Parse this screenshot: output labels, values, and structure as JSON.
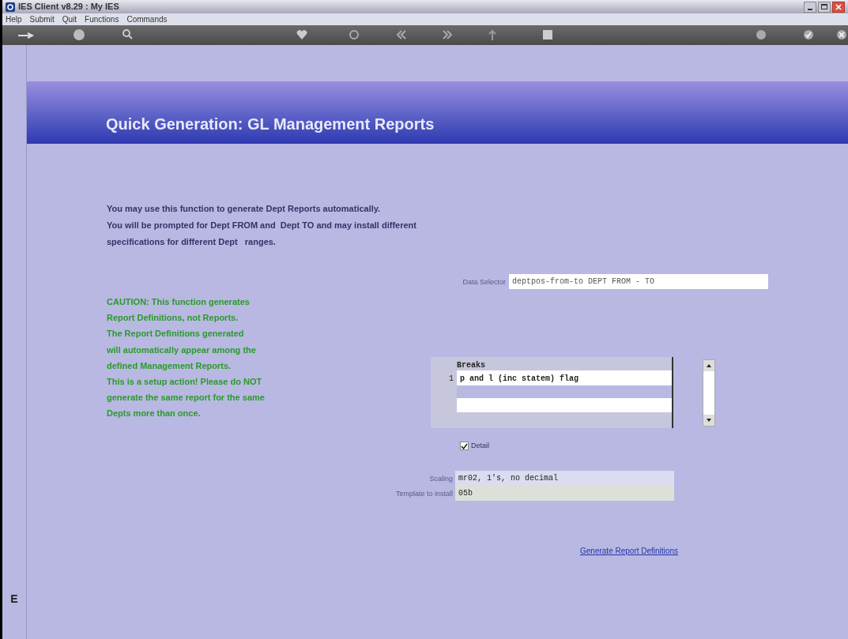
{
  "window": {
    "title": "IES Client v8.29 : My IES"
  },
  "menu": [
    "Help",
    "Submit",
    "Quit",
    "Functions",
    "Commands"
  ],
  "header": {
    "title": "Quick Generation: GL Management Reports"
  },
  "intro": [
    "You may use this function to generate Dept Reports automatically.",
    "You will be prompted for Dept FROM and  Dept TO and may install different",
    "specifications for different Dept   ranges."
  ],
  "caution": [
    "CAUTION: This function generates",
    "Report Definitions, not Reports.",
    "The Report Definitions generated",
    "will automatically appear among the",
    "defined Management Reports.",
    "This is a setup action! Please do NOT",
    "generate the same report for the same",
    "Depts more than once."
  ],
  "data_selector": {
    "label": "Data Selector",
    "value": "deptpos-from-to DEPT FROM - TO"
  },
  "breaks": {
    "heading": "Breaks",
    "rows": [
      {
        "number": "1",
        "value": "p and l (inc statem) flag"
      }
    ]
  },
  "detail": {
    "label": "Detail",
    "checked": true
  },
  "scaling": {
    "label": "Scaling",
    "value": "mr02, 1's, no decimal"
  },
  "template": {
    "label": "Template to install",
    "value": "05b"
  },
  "generate_link": "Generate Report Definitions",
  "side_tab": "E"
}
